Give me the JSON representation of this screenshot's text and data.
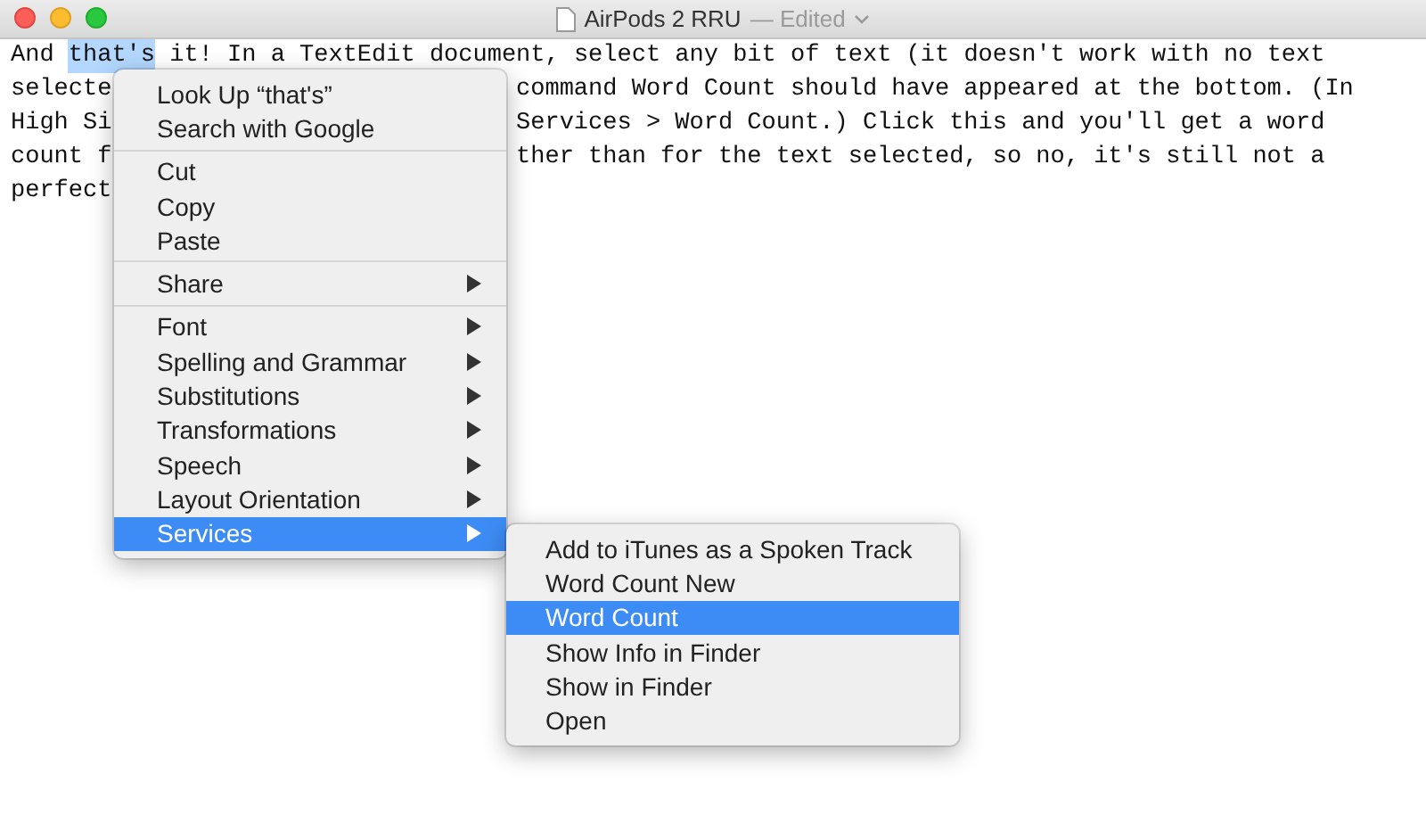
{
  "window": {
    "title": "AirPods 2 RRU",
    "status": "— Edited"
  },
  "document": {
    "lines": [
      {
        "segments": [
          {
            "text": "And ",
            "selected": false
          },
          {
            "text": "that's",
            "selected": true
          },
          {
            "text": " it! In a TextEdit document, select any bit of text (it doesn't work with no text",
            "selected": false
          }
        ]
      },
      {
        "segments": [
          {
            "text": "selecte",
            "selected": false
          }
        ],
        "right": "command Word Count should have appeared at the bottom. (In"
      },
      {
        "segments": [
          {
            "text": "High Si",
            "selected": false
          }
        ],
        "right": "Services > Word Count.) Click this and you'll get a word"
      },
      {
        "segments": [
          {
            "text": "count f",
            "selected": false
          }
        ],
        "right": "ther than for the text selected, so no, it's still not a"
      },
      {
        "segments": [
          {
            "text": "perfect",
            "selected": false
          }
        ]
      }
    ]
  },
  "context_menu": {
    "items": [
      {
        "kind": "item",
        "label": "Look Up “that's”",
        "submenu": false,
        "selected": false
      },
      {
        "kind": "item",
        "label": "Search with Google",
        "submenu": false,
        "selected": false
      },
      {
        "kind": "separator"
      },
      {
        "kind": "item",
        "label": "Cut",
        "submenu": false,
        "selected": false
      },
      {
        "kind": "item",
        "label": "Copy",
        "submenu": false,
        "selected": false
      },
      {
        "kind": "item",
        "label": "Paste",
        "submenu": false,
        "selected": false
      },
      {
        "kind": "separator"
      },
      {
        "kind": "item",
        "label": "Share",
        "submenu": true,
        "selected": false
      },
      {
        "kind": "separator"
      },
      {
        "kind": "item",
        "label": "Font",
        "submenu": true,
        "selected": false
      },
      {
        "kind": "item",
        "label": "Spelling and Grammar",
        "submenu": true,
        "selected": false
      },
      {
        "kind": "item",
        "label": "Substitutions",
        "submenu": true,
        "selected": false
      },
      {
        "kind": "item",
        "label": "Transformations",
        "submenu": true,
        "selected": false
      },
      {
        "kind": "item",
        "label": "Speech",
        "submenu": true,
        "selected": false
      },
      {
        "kind": "item",
        "label": "Layout Orientation",
        "submenu": true,
        "selected": false
      },
      {
        "kind": "item",
        "label": "Services",
        "submenu": true,
        "selected": true
      }
    ]
  },
  "services_menu": {
    "items": [
      {
        "kind": "item",
        "label": "Add to iTunes as a Spoken Track",
        "submenu": false,
        "selected": false
      },
      {
        "kind": "item",
        "label": "Word Count New",
        "submenu": false,
        "selected": false
      },
      {
        "kind": "item",
        "label": "Word Count",
        "submenu": false,
        "selected": true
      },
      {
        "kind": "item",
        "label": "Show Info in Finder",
        "submenu": false,
        "selected": false
      },
      {
        "kind": "item",
        "label": "Show in Finder",
        "submenu": false,
        "selected": false
      },
      {
        "kind": "item",
        "label": "Open",
        "submenu": false,
        "selected": false
      }
    ]
  }
}
